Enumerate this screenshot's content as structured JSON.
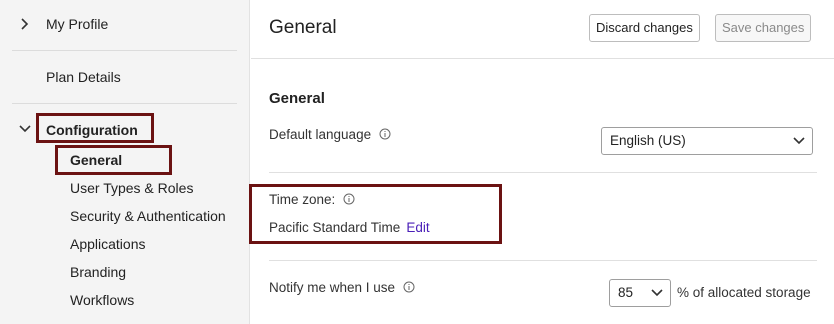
{
  "sidebar": {
    "my_profile": "My Profile",
    "plan_details": "Plan Details",
    "configuration": "Configuration",
    "items": [
      {
        "label": "General"
      },
      {
        "label": "User Types & Roles"
      },
      {
        "label": "Security & Authentication"
      },
      {
        "label": "Applications"
      },
      {
        "label": "Branding"
      },
      {
        "label": "Workflows"
      }
    ]
  },
  "header": {
    "title": "General",
    "discard_label": "Discard changes",
    "save_label": "Save changes"
  },
  "general": {
    "section_title": "General",
    "default_language_label": "Default language",
    "default_language_value": "English (US)",
    "time_zone_label": "Time zone:",
    "time_zone_value": "Pacific Standard Time",
    "edit_label": "Edit",
    "notify_label": "Notify me when I use",
    "notify_value": "85",
    "notify_suffix": "% of allocated storage"
  },
  "colors": {
    "highlight_border": "#6b1212",
    "link": "#4a1fb8",
    "sidebar_bg": "#f4f4f4"
  },
  "icons": [
    "chevron-right-icon",
    "chevron-down-icon",
    "info-icon",
    "caret-down-icon"
  ]
}
